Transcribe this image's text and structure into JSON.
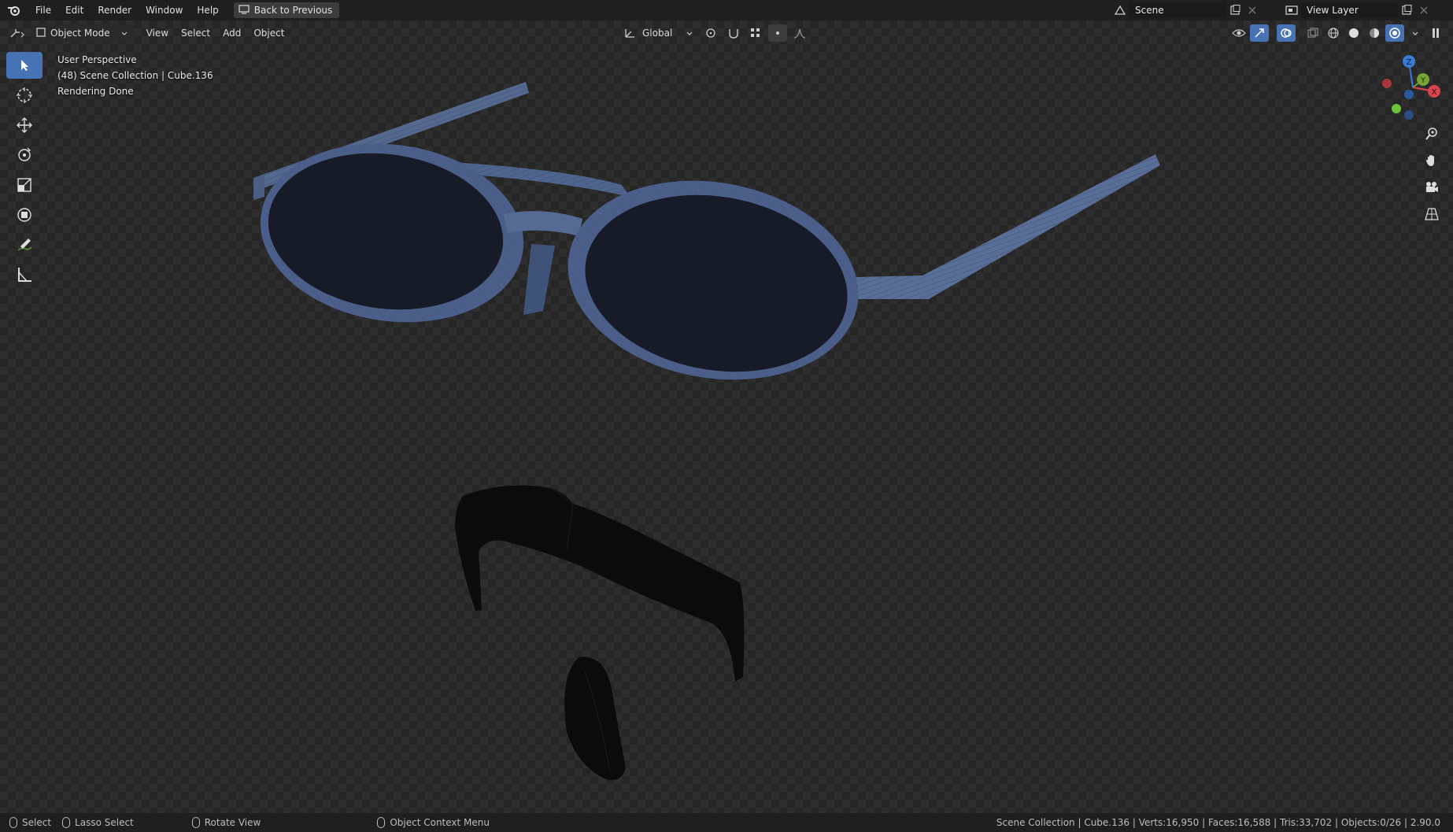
{
  "topbar": {
    "menus": [
      "File",
      "Edit",
      "Render",
      "Window",
      "Help"
    ],
    "back_button": "Back to Previous",
    "scene_name": "Scene",
    "view_layer": "View Layer"
  },
  "header": {
    "mode": "Object Mode",
    "menus": [
      "View",
      "Select",
      "Add",
      "Object"
    ],
    "transform_orientation": "Global"
  },
  "viewport": {
    "perspective": "User Perspective",
    "collection": "(48) Scene Collection | Cube.136",
    "status": "Rendering Done"
  },
  "gizmo": {
    "z": "Z",
    "y": "Y",
    "x": "X"
  },
  "status": {
    "select": "Select",
    "lasso": "Lasso Select",
    "rotate": "Rotate View",
    "context": "Object Context Menu",
    "stats": "Scene Collection | Cube.136 | Verts:16,950 | Faces:16,588 | Tris:33,702 | Objects:0/26 | 2.90.0"
  },
  "colors": {
    "accent": "#4772b3",
    "frame": "#4b5f8a",
    "lens": "#161b27"
  }
}
